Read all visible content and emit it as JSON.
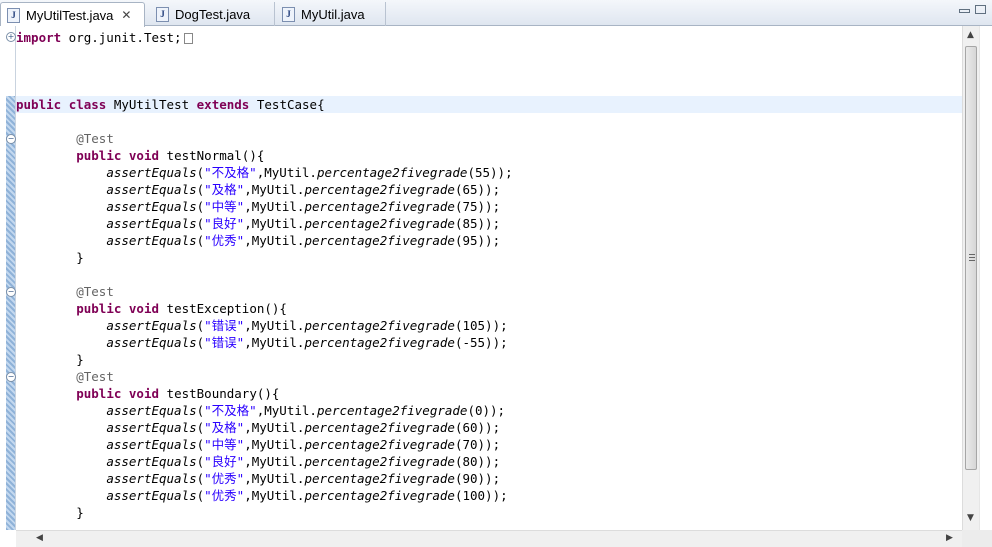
{
  "tabs": [
    {
      "label": "MyUtilTest.java",
      "active": true,
      "icon": "java-file-icon",
      "closable": true
    },
    {
      "label": "DogTest.java",
      "active": false,
      "icon": "java-file-icon"
    },
    {
      "label": "MyUtil.java",
      "active": false,
      "icon": "java-file-icon"
    }
  ],
  "editor": {
    "import_line": "import org.junit.Test;",
    "class_line": {
      "kw1": "public",
      "kw2": "class",
      "name": "MyUtilTest",
      "kw3": "extends",
      "parent": "TestCase{"
    },
    "annotation": "@Test",
    "method_normal": {
      "mods": "public void",
      "sig": "testNormal(){"
    },
    "method_exception": {
      "mods": "public void",
      "sig": "testException(){"
    },
    "method_boundary": {
      "mods": "public void",
      "sig": "testBoundary(){"
    },
    "assert_name": "assertEquals",
    "call_prefix": ",MyUtil.",
    "call_name": "percentage2fivegrade",
    "close_brace": "}",
    "normal_asserts": [
      {
        "expected": "\"不及格\"",
        "arg": "(55));"
      },
      {
        "expected": "\"及格\"",
        "arg": "(65));"
      },
      {
        "expected": "\"中等\"",
        "arg": "(75));"
      },
      {
        "expected": "\"良好\"",
        "arg": "(85));"
      },
      {
        "expected": "\"优秀\"",
        "arg": "(95));"
      }
    ],
    "exception_asserts": [
      {
        "expected": "\"错误\"",
        "arg": "(105));"
      },
      {
        "expected": "\"错误\"",
        "arg": "(-55));"
      }
    ],
    "boundary_asserts": [
      {
        "expected": "\"不及格\"",
        "arg": "(0));"
      },
      {
        "expected": "\"及格\"",
        "arg": "(60));"
      },
      {
        "expected": "\"中等\"",
        "arg": "(70));"
      },
      {
        "expected": "\"良好\"",
        "arg": "(80));"
      },
      {
        "expected": "\"优秀\"",
        "arg": "(90));"
      },
      {
        "expected": "\"优秀\"",
        "arg": "(100));"
      }
    ]
  },
  "colors": {
    "keyword": "#7f0055",
    "string": "#2a00ff",
    "annotation": "#646464",
    "highlight_line": "#e8f2fe"
  }
}
